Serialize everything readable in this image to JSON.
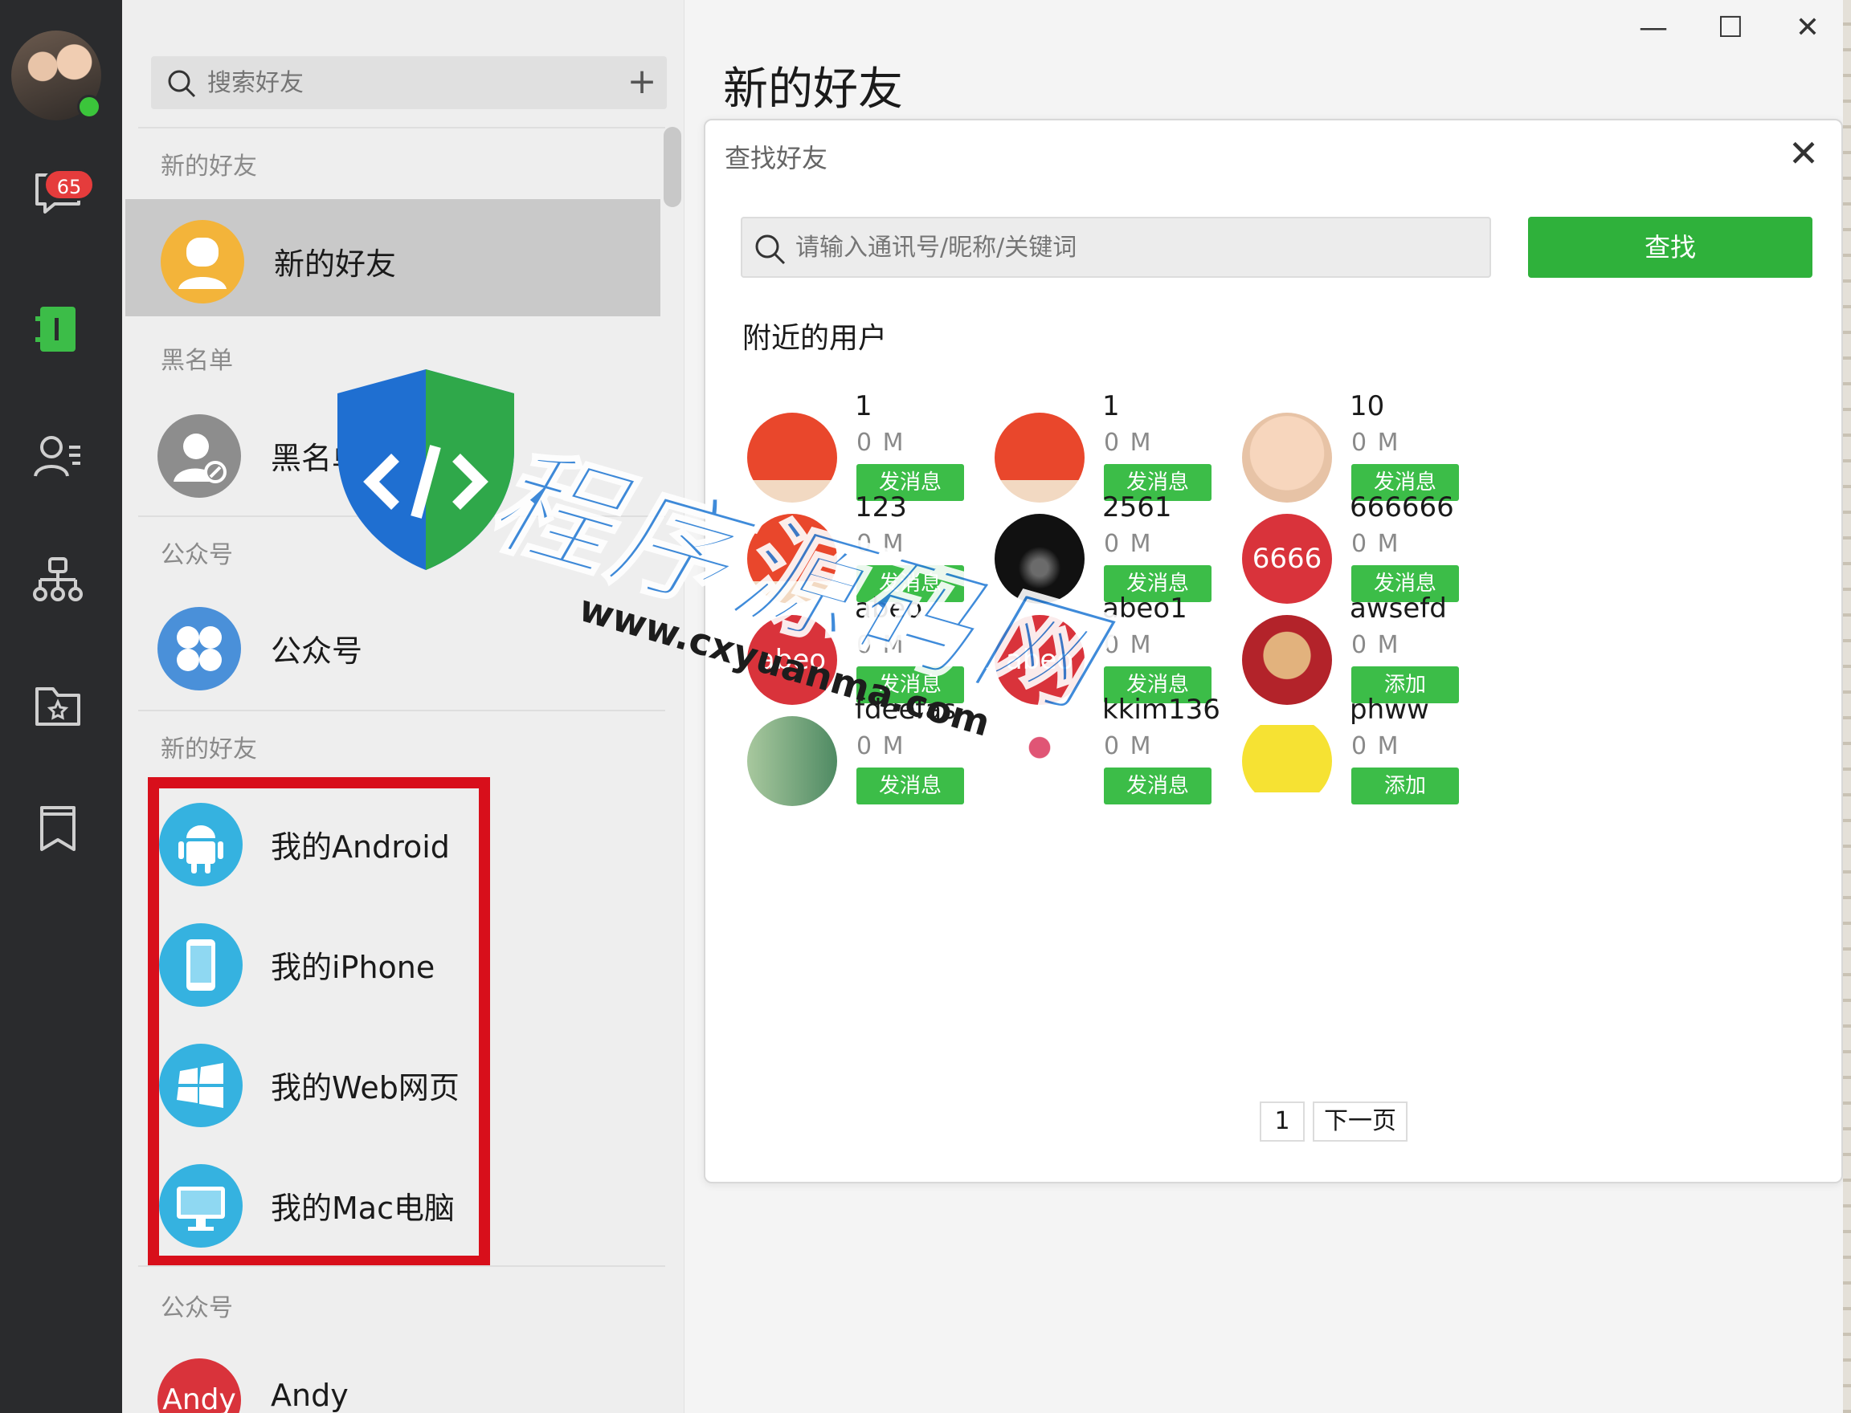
{
  "sidebar": {
    "unread_badge": "65",
    "icons": [
      "chat-icon",
      "address-book-icon",
      "contacts-icon",
      "org-chart-icon",
      "folder-icon",
      "bookmark-icon"
    ]
  },
  "contacts_panel": {
    "search_placeholder": "搜索好友",
    "add_label": "+",
    "sections": {
      "new_friends": "新的好友",
      "blacklist": "黑名单",
      "official": "公众号",
      "devices": "新的好友",
      "official2": "公众号"
    },
    "rows": {
      "new_friends": "新的好友",
      "blacklist": "黑名单",
      "official": "公众号",
      "android": "我的Android",
      "iphone": "我的iPhone",
      "web": "我的Web网页",
      "mac": "我的Mac电脑",
      "andy": "Andy",
      "andy_avatar_text": "Andy"
    }
  },
  "main": {
    "title": "新的好友",
    "window_controls": {
      "minimize": "—",
      "maximize": "☐",
      "close": "✕"
    }
  },
  "dialog": {
    "title": "查找好友",
    "close": "✕",
    "search_placeholder": "请输入通讯号/昵称/关键词",
    "search_button": "查找",
    "nearby_title": "附近的用户",
    "users": [
      {
        "name": "1",
        "distance": "0 M",
        "action": "发消息",
        "avatar": "orange",
        "avatar_text": ""
      },
      {
        "name": "1",
        "distance": "0 M",
        "action": "发消息",
        "avatar": "orange",
        "avatar_text": ""
      },
      {
        "name": "10",
        "distance": "0 M",
        "action": "发消息",
        "avatar": "baby",
        "avatar_text": ""
      },
      {
        "name": "123",
        "distance": "0 M",
        "action": "发消息",
        "avatar": "orange",
        "avatar_text": ""
      },
      {
        "name": "2561",
        "distance": "0 M",
        "action": "发消息",
        "avatar": "dark",
        "avatar_text": ""
      },
      {
        "name": "666666",
        "distance": "0 M",
        "action": "发消息",
        "avatar": "red",
        "avatar_text": "6666"
      },
      {
        "name": "abeo",
        "distance": "0 M",
        "action": "发消息",
        "avatar": "red",
        "avatar_text": "abeo"
      },
      {
        "name": "abeo1",
        "distance": "0 M",
        "action": "发消息",
        "avatar": "red",
        "avatar_text": "abeo"
      },
      {
        "name": "awsefd",
        "distance": "0 M",
        "action": "添加",
        "avatar": "monkey",
        "avatar_text": ""
      },
      {
        "name": "fdeefas",
        "distance": "0 M",
        "action": "发消息",
        "avatar": "green",
        "avatar_text": ""
      },
      {
        "name": "kkim136",
        "distance": "0 M",
        "action": "发消息",
        "avatar": "white",
        "avatar_text": ""
      },
      {
        "name": "phww",
        "distance": "0 M",
        "action": "添加",
        "avatar": "yellow",
        "avatar_text": ""
      }
    ],
    "pager": {
      "current": "1",
      "next": "下一页"
    }
  },
  "watermark": {
    "text": "程序源码网",
    "url": "www.cxyuanma.com"
  },
  "colors": {
    "accent_green": "#3cbd48",
    "highlight_red": "#d80f1b",
    "sidebar": "#2a2b2d"
  }
}
